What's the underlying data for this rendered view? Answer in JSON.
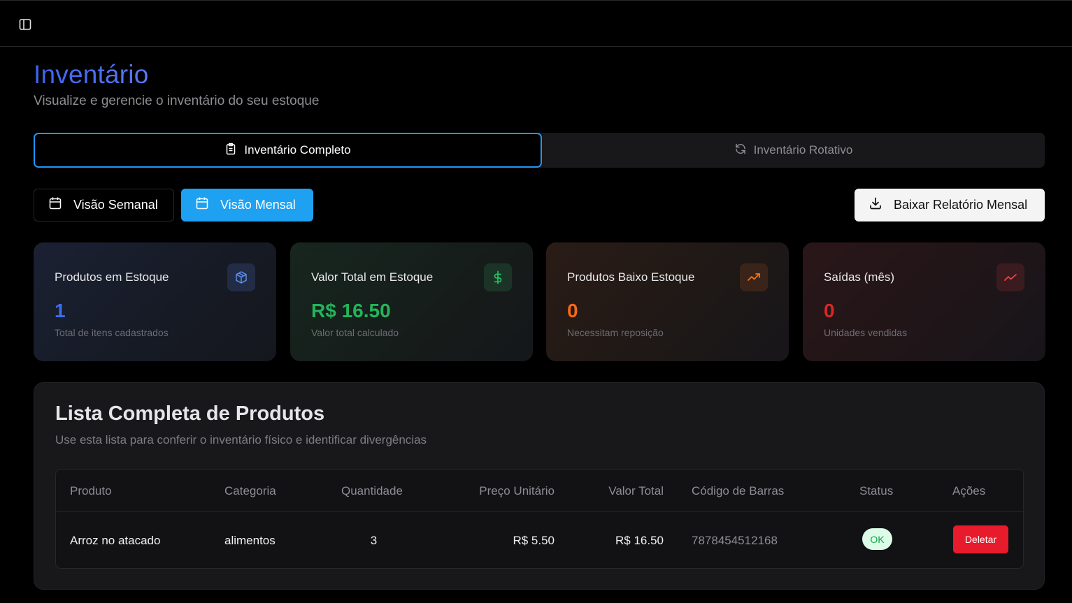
{
  "header": {
    "sidebar_toggle_icon": "sidebar-panel-icon"
  },
  "page": {
    "title": "Inventário",
    "subtitle": "Visualize e gerencie o inventário do seu estoque"
  },
  "tabs": [
    {
      "label": "Inventário Completo",
      "icon": "clipboard-icon",
      "active": true
    },
    {
      "label": "Inventário Rotativo",
      "icon": "refresh-icon",
      "active": false
    }
  ],
  "toolbar": {
    "weekly_label": "Visão Semanal",
    "monthly_label": "Visão Mensal",
    "download_label": "Baixar Relatório Mensal"
  },
  "cards": [
    {
      "label": "Produtos em Estoque",
      "value": "1",
      "hint": "Total de itens cadastrados",
      "icon": "box-icon",
      "color": "#3b82f6"
    },
    {
      "label": "Valor Total em Estoque",
      "value": "R$ 16.50",
      "hint": "Valor total calculado",
      "icon": "dollar-icon",
      "color": "#22c55e"
    },
    {
      "label": "Produtos Baixo Estoque",
      "value": "0",
      "hint": "Necessitam reposição",
      "icon": "trending-up-icon",
      "color": "#f97316"
    },
    {
      "label": "Saídas (mês)",
      "value": "0",
      "hint": "Unidades vendidas",
      "icon": "trending-down-icon",
      "color": "#ef4444"
    }
  ],
  "products": {
    "title": "Lista Completa de Produtos",
    "subtitle": "Use esta lista para conferir o inventário físico e identificar divergências",
    "columns": [
      "Produto",
      "Categoria",
      "Quantidade",
      "Preço Unitário",
      "Valor Total",
      "Código de Barras",
      "Status",
      "Ações"
    ],
    "rows": [
      {
        "produto": "Arroz no atacado",
        "categoria": "alimentos",
        "quantidade": "3",
        "preco": "R$ 5.50",
        "valor_total": "R$ 16.50",
        "codigo": "7878454512168",
        "status": "OK",
        "acao": "Deletar"
      }
    ]
  }
}
